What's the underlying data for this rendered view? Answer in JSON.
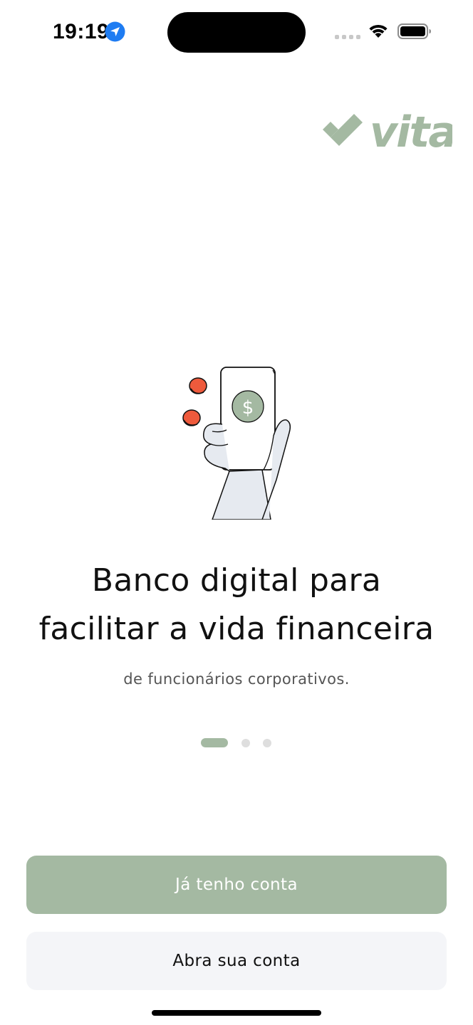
{
  "status_bar": {
    "time": "19:19",
    "location_icon": "location-arrow-icon",
    "signal_icon": "cellular-signal-icon",
    "wifi_icon": "wifi-icon",
    "battery_icon": "battery-icon"
  },
  "logo": {
    "text": "vita",
    "mark_icon": "checkmark-icon",
    "color": "#a4b9a2"
  },
  "illustration": {
    "icon": "hand-holding-phone-with-dollar-icon",
    "coin_color": "#ee5a3c",
    "dollar_symbol": "$"
  },
  "headline": {
    "line1": "Banco digital para",
    "line2": "facilitar a vida financeira"
  },
  "subtitle": "de funcionários corporativos.",
  "pagination": {
    "total": 3,
    "active_index": 0
  },
  "buttons": {
    "primary_label": "Já tenho conta",
    "secondary_label": "Abra sua conta"
  },
  "colors": {
    "accent": "#a4b9a2",
    "secondary_button_bg": "#f4f5f8",
    "location_blue": "#1e7cf2"
  }
}
